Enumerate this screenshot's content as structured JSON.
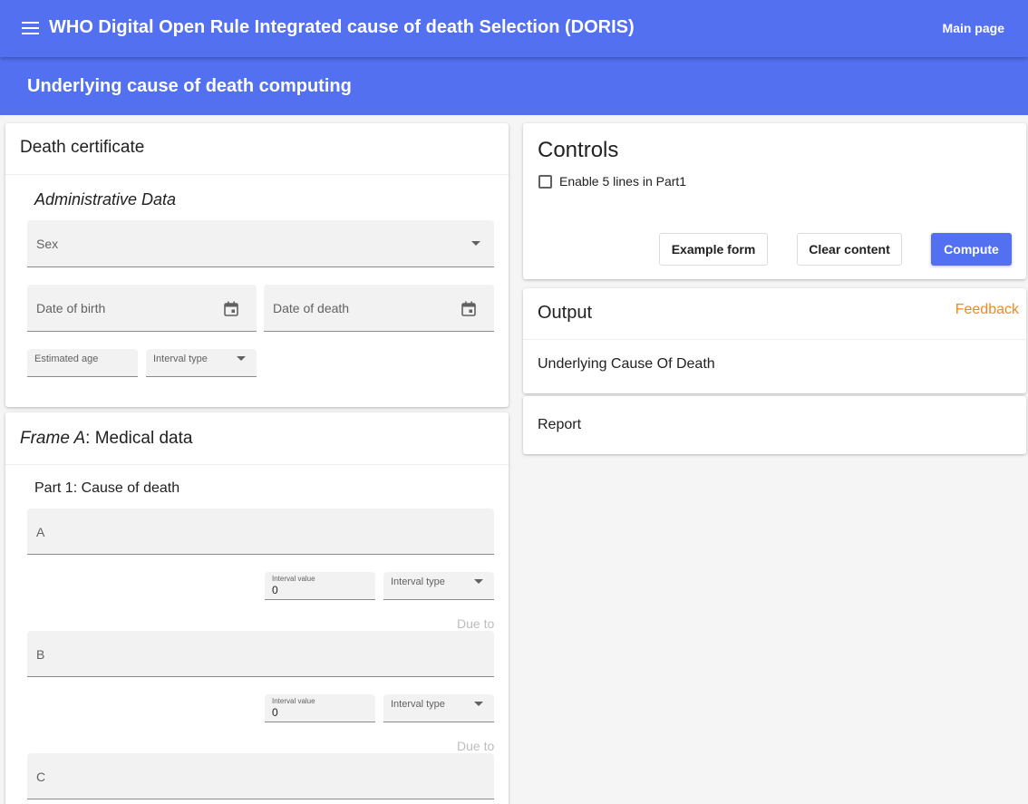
{
  "app": {
    "title": "WHO Digital Open Rule Integrated cause of death Selection (DORIS)",
    "main_page_link": "Main page",
    "page_title": "Underlying cause of death computing"
  },
  "death_certificate": {
    "title": "Death certificate",
    "administrative": {
      "title": "Administrative Data",
      "sex_label": "Sex",
      "date_of_birth_label": "Date of birth",
      "date_of_death_label": "Date of death",
      "estimated_age_label": "Estimated age",
      "interval_type_label": "Interval type"
    }
  },
  "frame_a": {
    "title_italic": "Frame A",
    "title_rest": ": Medical data",
    "part1_title": "Part 1: Cause of death",
    "lines": [
      {
        "label": "A",
        "interval_value_label": "Interval value",
        "interval_value": "0",
        "interval_type_label": "Interval type",
        "due_to": "Due to"
      },
      {
        "label": "B",
        "interval_value_label": "Interval value",
        "interval_value": "0",
        "interval_type_label": "Interval type",
        "due_to": "Due to"
      },
      {
        "label": "C"
      }
    ]
  },
  "controls": {
    "title": "Controls",
    "enable_5_lines_label": "Enable 5 lines in Part1",
    "enable_5_lines_checked": false,
    "example_form_button": "Example form",
    "clear_content_button": "Clear content",
    "compute_button": "Compute"
  },
  "output": {
    "title": "Output",
    "feedback_link": "Feedback",
    "underlying_cause_title": "Underlying Cause Of Death",
    "report_title": "Report"
  },
  "colors": {
    "primary": "#5370f0",
    "feedback": "#f0891e",
    "field_bg": "#f2f2f2"
  }
}
